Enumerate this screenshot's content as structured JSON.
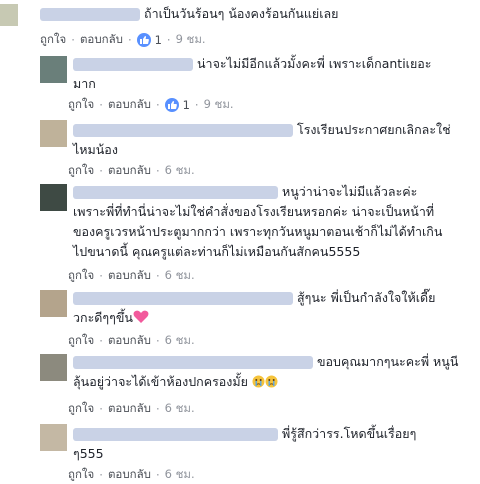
{
  "labels": {
    "like": "ถูกใจ",
    "reply": "ตอบกลับ"
  },
  "comments": [
    {
      "text": "ถ้าเป็นวันร้อนๆ น้องคงร้อนกันแย่เลย",
      "likes": "1",
      "time": "9 ชม.",
      "reacted": true
    },
    {
      "text": "น่าจะไม่มีอีกแล้วมั้งคะพี่ เพราะเด็กantiเยอะ\nมาก",
      "likes": "1",
      "time": "9 ชม.",
      "reacted": true
    },
    {
      "text": "โรงเรียนประกาศยกเลิกละใช่\nไหมน้อง",
      "likes": "",
      "time": "6 ชม.",
      "reacted": false
    },
    {
      "text": "หนูว่าน่าจะไม่มีแล้วละค่ะ\nเพราะพี่ที่ทำนี่น่าจะไม่ใช่คำสั่งของโรงเรียนหรอกค่ะ น่าจะเป็นหน้าที่\nของครูเวรหน้าประตูมากกว่า เพราะทุกวันหนูมาตอนเช้าก็ไม่ได้ทำเกิน\nไปขนาดนี้ คุณครูแต่ละท่านก็ไม่เหมือนกันสักคน5555",
      "likes": "",
      "time": "6 ชม.",
      "reacted": false
    },
    {
      "text": "สู้ๆนะ พี่เป็นกำลังใจให้เดี๊ย\nวกะดีๆๆขึ้น",
      "likes": "",
      "time": "6 ชม.",
      "reacted": false
    },
    {
      "text": "ขอบคุณมากๆนะคะพี่ หนูนี\nลุ้นอยู่ว่าจะได้เข้าห้องปกครองมั้ย",
      "likes": "",
      "time": "6 ชม.",
      "reacted": false
    },
    {
      "text": "พี่รู้สึกว่ารร.โหดขึ้นเรื่อยๆ\nๆ555",
      "likes": "",
      "time": "6 ชม.",
      "reacted": false
    }
  ],
  "colors": {
    "link": "#4b4f56",
    "like_badge": "#5890ff",
    "name_blur": "#c9d2e6"
  }
}
